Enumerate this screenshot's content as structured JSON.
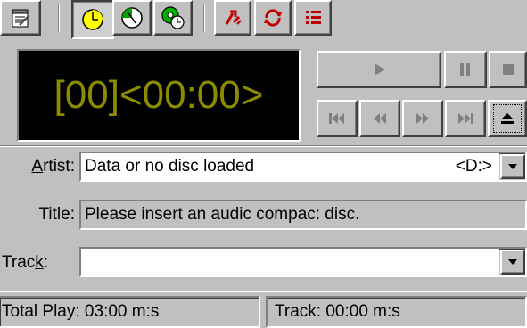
{
  "display": {
    "time_readout": "[00]<00:00>"
  },
  "fields": {
    "artist": {
      "label_pre": "",
      "label_accel": "A",
      "label_post": "rtist:",
      "value": "Data or no disc loaded",
      "drive": "<D:>"
    },
    "title": {
      "label": "Title:",
      "value": "Please insert an audic compac: disc."
    },
    "track": {
      "label_pre": "Trac",
      "label_accel": "k",
      "label_post": ":",
      "value": ""
    }
  },
  "status_bar": {
    "total_play": "Total Play: 03:00 m:s",
    "track": "Track: 00:00 m:s"
  }
}
